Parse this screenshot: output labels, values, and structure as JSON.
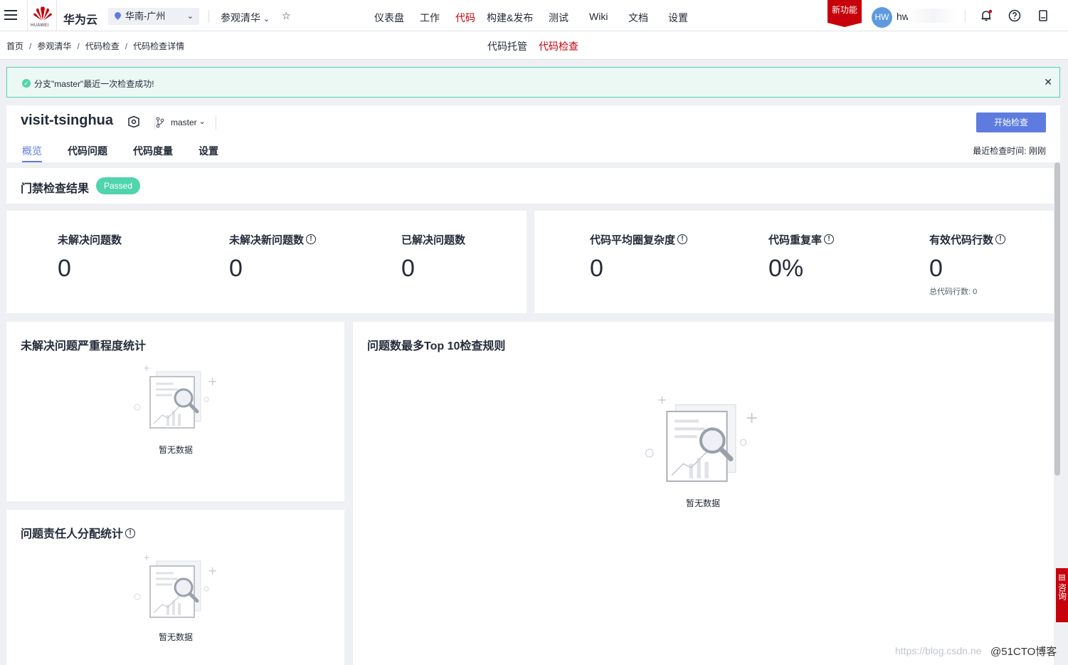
{
  "topbar": {
    "brand": "华为云",
    "logo_text": "HUAWEI",
    "region": "华南-广州",
    "project": "参观清华",
    "nav": [
      "仪表盘",
      "工作",
      "代码",
      "构建&发布",
      "测试",
      "Wiki",
      "文档",
      "设置"
    ],
    "active_nav": "代码",
    "new_feature": "新功能",
    "avatar": "HW",
    "username": "hw"
  },
  "subbar": {
    "breadcrumb": [
      "首页",
      "参观清华",
      "代码检查",
      "代码检查详情"
    ],
    "tabs": [
      "代码托管",
      "代码检查"
    ],
    "active_tab": "代码检查"
  },
  "alert": {
    "message": "分支\"master\"最近一次检查成功!"
  },
  "repo": {
    "name": "visit-tsinghua",
    "branch": "master",
    "start_button": "开始检查",
    "tabs": [
      "概览",
      "代码问题",
      "代码度量",
      "设置"
    ],
    "last_check_label": "最近检查时间:",
    "last_check_value": "刚刚"
  },
  "gate": {
    "title": "门禁检查结果",
    "status": "Passed"
  },
  "issues": [
    {
      "label": "未解决问题数",
      "value": "0"
    },
    {
      "label": "未解决新问题数",
      "value": "0"
    },
    {
      "label": "已解决问题数",
      "value": "0"
    }
  ],
  "metrics": [
    {
      "label": "代码平均圈复杂度",
      "value": "0"
    },
    {
      "label": "代码重复率",
      "value": "0%"
    },
    {
      "label": "有效代码行数",
      "value": "0",
      "sub": "总代码行数: 0"
    }
  ],
  "severity": {
    "title": "未解决问题严重程度统计",
    "empty": "暂无数据"
  },
  "top_rules": {
    "title": "问题数最多Top 10检查规则",
    "empty": "暂无数据"
  },
  "assignee": {
    "title": "问题责任人分配统计",
    "empty": "暂无数据"
  },
  "float_button": "咨询",
  "watermark": {
    "url": "https://blog.csdn.ne",
    "site": "@51CTO博客"
  },
  "colors": {
    "brand_red": "#c7000b",
    "primary": "#5e7ce0",
    "success": "#50d4ab"
  }
}
